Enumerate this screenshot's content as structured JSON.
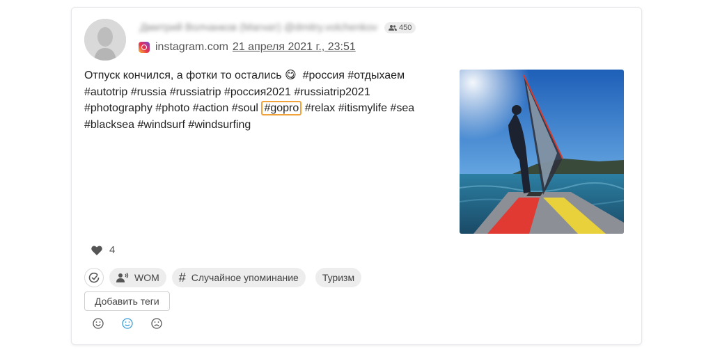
{
  "author": {
    "name": "Дмитрий Волчанков (Магнат) @dmitry.volchenkov",
    "audience_badge": "450"
  },
  "source": {
    "site": "instagram.com",
    "date": "21 апреля 2021 г., 23:51"
  },
  "post": {
    "line1_text": "Отпуск кончился, а фотки то остались",
    "line1_emoji": "😋",
    "line1_tags": "#россия #отдыхаем",
    "line2": "#autotrip #russia #russiatrip #россия2021 #russiatrip2021",
    "line3_before": "#photography #photo #action #soul",
    "line3_highlight": "#gopro",
    "line3_after": "#relax #itismylife #sea",
    "line4": "#blacksea #windsurf  #windsurfing"
  },
  "likes": {
    "count": "4"
  },
  "tags": {
    "wom_label": "WOM",
    "mention_label": "Случайное упоминание",
    "topic_label": "Туризм",
    "add_tags_label": "Добавить теги"
  },
  "sentiment": {
    "selected": "neutral"
  },
  "colors": {
    "highlight_border": "#f2a23a",
    "neutral_selected": "#3a9bd9",
    "chip_bg": "#ededed"
  }
}
